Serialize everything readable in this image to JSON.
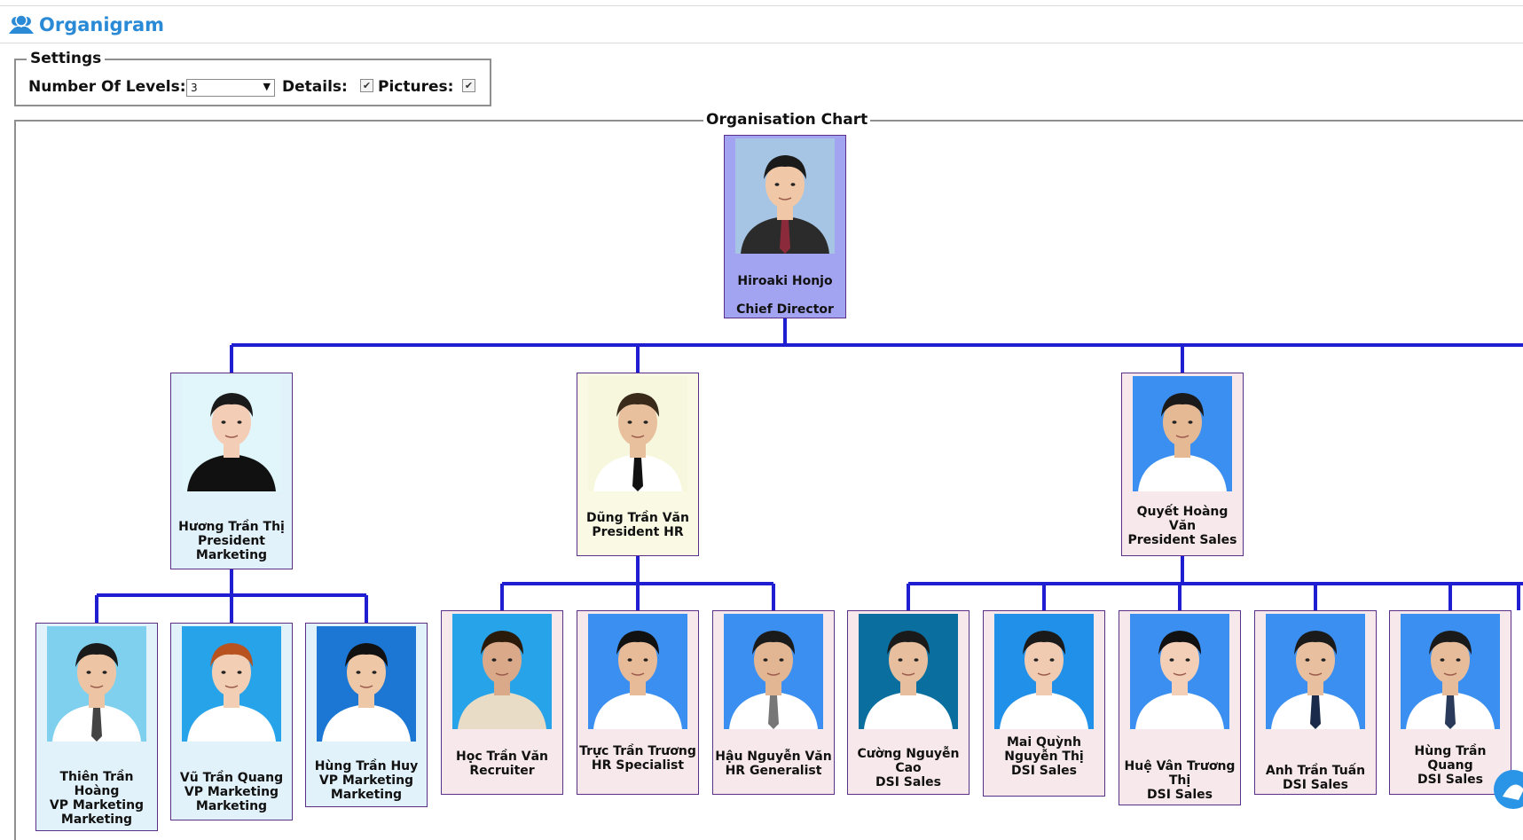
{
  "header": {
    "title": "Organigram",
    "icon": "users-icon"
  },
  "settings": {
    "legend": "Settings",
    "levels_label": "Number Of Levels:",
    "levels_value": "3",
    "details_label": "Details:",
    "details_checked": true,
    "pictures_label": "Pictures:",
    "pictures_checked": true
  },
  "chart": {
    "legend": "Organisation Chart",
    "connector_color": "#1f1fd1",
    "root_color": "#a3a4f1",
    "level2_colors": [
      "#e2f2fb",
      "#fafae4",
      "#f7e8ec"
    ],
    "level3_colors": [
      "#e2f2fb",
      "#f7e8ec"
    ],
    "nodes": [
      {
        "name": "Hiroaki Honjo",
        "title": "Chief Director"
      },
      {
        "name": "Hương Trần Thị",
        "title": "President Marketing"
      },
      {
        "name": "Dũng Trần Văn",
        "title": "President HR"
      },
      {
        "name": "Quyết Hoàng Văn",
        "title": "President Sales"
      },
      {
        "name": "Thiên Trần Hoàng",
        "title": "VP Marketing Marketing"
      },
      {
        "name": "Vũ Trần Quang",
        "title": "VP Marketing Marketing"
      },
      {
        "name": "Hùng Trần Huy",
        "title": "VP Marketing Marketing"
      },
      {
        "name": "Học Trần Văn",
        "title": "Recruiter"
      },
      {
        "name": "Trực Trần Trương",
        "title": "HR Specialist"
      },
      {
        "name": "Hậu Nguyễn Văn",
        "title": "HR Generalist"
      },
      {
        "name": "Cường Nguyễn Cao",
        "title": "DSI Sales"
      },
      {
        "name": "Mai Quỳnh Nguyễn Thị",
        "title": "DSI Sales"
      },
      {
        "name": "Huệ Vân Trương Thị",
        "title": "DSI Sales"
      },
      {
        "name": "Anh Trần Tuấn",
        "title": "DSI Sales"
      },
      {
        "name": "Hùng Trần Quang",
        "title": "DSI Sales"
      }
    ]
  },
  "chat_icon": "chat-icon"
}
